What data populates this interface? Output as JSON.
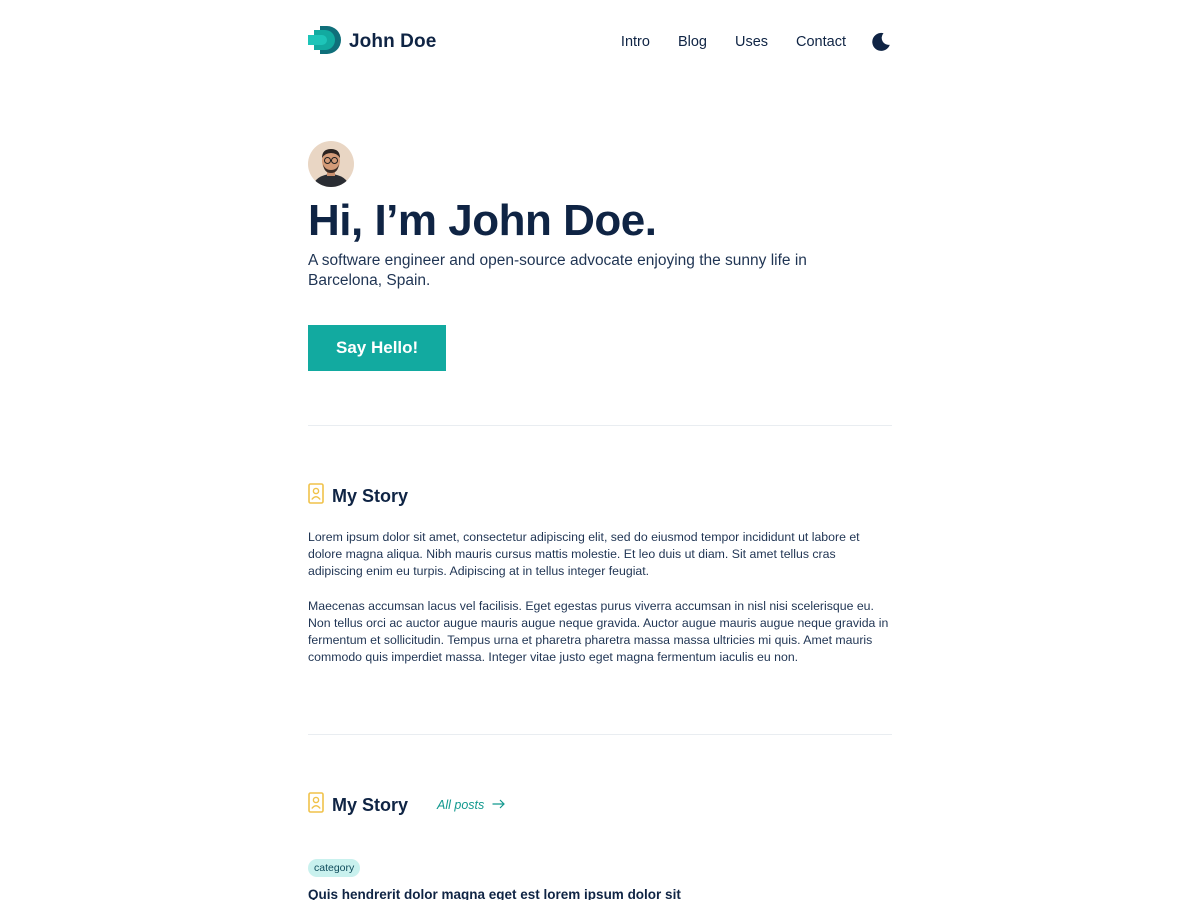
{
  "header": {
    "brand_name": "John Doe",
    "nav": [
      "Intro",
      "Blog",
      "Uses",
      "Contact"
    ],
    "theme_toggle_icon": "moon-icon"
  },
  "hero": {
    "title": "Hi, I’m John Doe.",
    "subtitle": "A software engineer and open-source advocate enjoying the sunny life in Barcelona, Spain.",
    "cta_label": "Say Hello!"
  },
  "story": {
    "icon": "id-card-icon",
    "title": "My Story",
    "paragraphs": [
      "Lorem ipsum dolor sit amet, consectetur adipiscing elit, sed do eiusmod tempor incididunt ut labore et dolore magna aliqua. Nibh mauris cursus mattis molestie. Et leo duis ut diam. Sit amet tellus cras adipiscing enim eu turpis. Adipiscing at in tellus integer feugiat.",
      "Maecenas accumsan lacus vel facilisis. Eget egestas purus viverra accumsan in nisl nisi scelerisque eu. Non tellus orci ac auctor augue mauris augue neque gravida. Auctor augue mauris augue neque gravida in fermentum et sollicitudin. Tempus urna et pharetra pharetra massa massa ultricies mi quis. Amet mauris commodo quis imperdiet massa. Integer vitae justo eget magna fermentum iaculis eu non."
    ]
  },
  "posts": {
    "icon": "id-card-icon",
    "title": "My Story",
    "all_posts_label": "All posts",
    "all_posts_icon": "arrow-right-icon",
    "items": [
      {
        "category": "category",
        "title": "Quis hendrerit dolor magna eget est lorem ipsum dolor sit"
      }
    ]
  },
  "colors": {
    "accent": "#12aaa0",
    "text": "#0f2444",
    "icon_yellow": "#f0c24a",
    "badge_bg": "#c9f1ee"
  }
}
